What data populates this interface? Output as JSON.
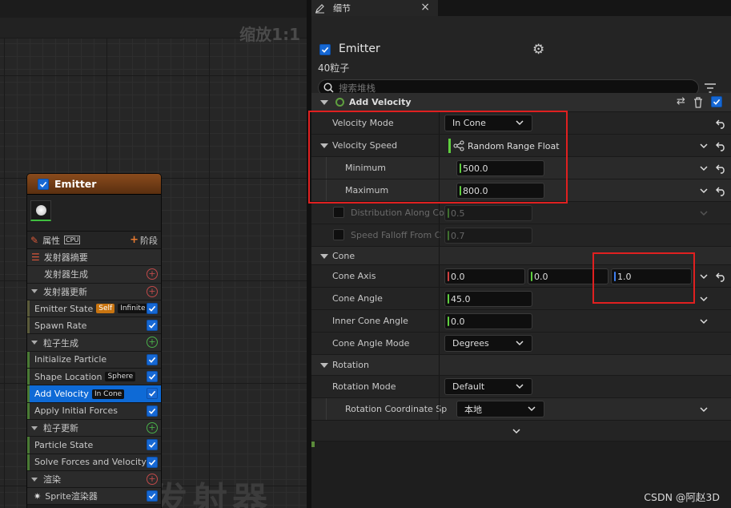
{
  "graph": {
    "zoom_label": "缩放1:1",
    "watermark": "发射器"
  },
  "node": {
    "title": "Emitter",
    "toolbar": {
      "properties_label": "属性",
      "cpu_badge": "CPU",
      "stage_label": "阶段"
    },
    "rows": [
      {
        "label": "发射器摘要",
        "type": "summary"
      },
      {
        "label": "发射器生成",
        "type": "group"
      },
      {
        "label": "发射器更新",
        "type": "section"
      },
      {
        "label": "Emitter State",
        "badges": [
          "Self",
          "Infinite"
        ],
        "type": "item"
      },
      {
        "label": "Spawn Rate",
        "type": "item"
      },
      {
        "label": "粒子生成",
        "type": "section"
      },
      {
        "label": "Initialize Particle",
        "type": "item"
      },
      {
        "label": "Shape Location",
        "badges": [
          "Sphere"
        ],
        "type": "item"
      },
      {
        "label": "Add Velocity",
        "badges": [
          "In Cone"
        ],
        "type": "item",
        "selected": true
      },
      {
        "label": "Apply Initial Forces",
        "type": "item"
      },
      {
        "label": "粒子更新",
        "type": "section"
      },
      {
        "label": "Particle State",
        "type": "item"
      },
      {
        "label": "Solve Forces and Velocity",
        "type": "item"
      },
      {
        "label": "渲染",
        "type": "section"
      },
      {
        "label": "Sprite渲染器",
        "type": "item"
      }
    ]
  },
  "details": {
    "tab_label": "细节",
    "emitter_name": "Emitter",
    "particle_count": "40粒子",
    "search_placeholder": "搜索堆栈",
    "module_title": "Add Velocity",
    "velocity_mode": {
      "label": "Velocity Mode",
      "value": "In Cone"
    },
    "velocity_speed": {
      "label": "Velocity Speed",
      "value": "Random Range Float"
    },
    "minimum": {
      "label": "Minimum",
      "value": "500.0"
    },
    "maximum": {
      "label": "Maximum",
      "value": "800.0"
    },
    "distribution": {
      "label": "Distribution Along Co",
      "value": "0.5"
    },
    "speed_falloff": {
      "label": "Speed Falloff From C",
      "value": "0.7"
    },
    "cone_category": "Cone",
    "cone_axis": {
      "label": "Cone Axis",
      "x": "0.0",
      "y": "0.0",
      "z": "1.0"
    },
    "cone_angle": {
      "label": "Cone Angle",
      "value": "45.0"
    },
    "inner_cone_angle": {
      "label": "Inner Cone Angle",
      "value": "0.0"
    },
    "cone_angle_mode": {
      "label": "Cone Angle Mode",
      "value": "Degrees"
    },
    "rotation_category": "Rotation",
    "rotation_mode": {
      "label": "Rotation Mode",
      "value": "Default"
    },
    "rotation_coord": {
      "label": "Rotation Coordinate Sp",
      "value": "本地"
    }
  },
  "credit": "CSDN @阿赵3D"
}
